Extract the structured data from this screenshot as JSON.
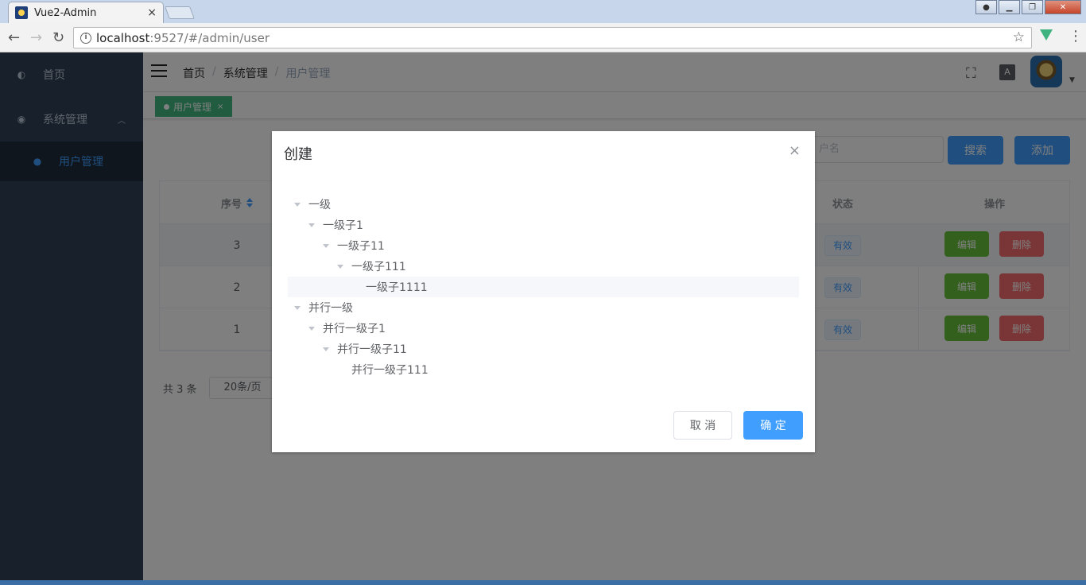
{
  "browser": {
    "tab_title": "Vue2-Admin",
    "tab_close": "×",
    "url_host": "localhost",
    "url_path": ":9527/#/admin/user"
  },
  "sidebar": {
    "items": [
      {
        "label": "首页",
        "icon": "dashboard-icon"
      },
      {
        "label": "系统管理",
        "icon": "user-group-icon"
      }
    ],
    "sub_items": [
      {
        "label": "用户管理",
        "icon": "user-icon"
      }
    ]
  },
  "navbar": {
    "breadcrumb": [
      "首页",
      "系统管理",
      "用户管理"
    ],
    "lang_label": "A"
  },
  "tags": [
    {
      "label": "用户管理",
      "close": "×"
    }
  ],
  "filters": {
    "input_placeholder": "户名",
    "search_label": "搜索",
    "add_label": "添加"
  },
  "table": {
    "headers": [
      "序号",
      "状态",
      "操作"
    ],
    "rows": [
      {
        "index": "3",
        "status": "有效",
        "edit": "编辑",
        "delete": "删除"
      },
      {
        "index": "2",
        "status": "有效",
        "edit": "编辑",
        "delete": "删除"
      },
      {
        "index": "1",
        "status": "有效",
        "edit": "编辑",
        "delete": "删除"
      }
    ]
  },
  "pager": {
    "total": "共 3 条",
    "page_size": "20条/页"
  },
  "dialog": {
    "title": "创建",
    "close": "×",
    "tree": [
      {
        "label": "一级",
        "level": 0,
        "leaf": false
      },
      {
        "label": "一级子1",
        "level": 1,
        "leaf": false
      },
      {
        "label": "一级子11",
        "level": 2,
        "leaf": false
      },
      {
        "label": "一级子111",
        "level": 3,
        "leaf": false
      },
      {
        "label": "一级子1111",
        "level": 4,
        "leaf": true
      },
      {
        "label": "并行一级",
        "level": 0,
        "leaf": false
      },
      {
        "label": "并行一级子1",
        "level": 1,
        "leaf": false
      },
      {
        "label": "并行一级子11",
        "level": 2,
        "leaf": false
      },
      {
        "label": "并行一级子111",
        "level": 3,
        "leaf": true
      }
    ],
    "cancel_label": "取 消",
    "confirm_label": "确 定"
  },
  "colors": {
    "sidebar_bg": "#304156",
    "primary": "#409eff",
    "success": "#67c23a",
    "danger": "#f56c6c",
    "tag_green": "#42b983"
  }
}
